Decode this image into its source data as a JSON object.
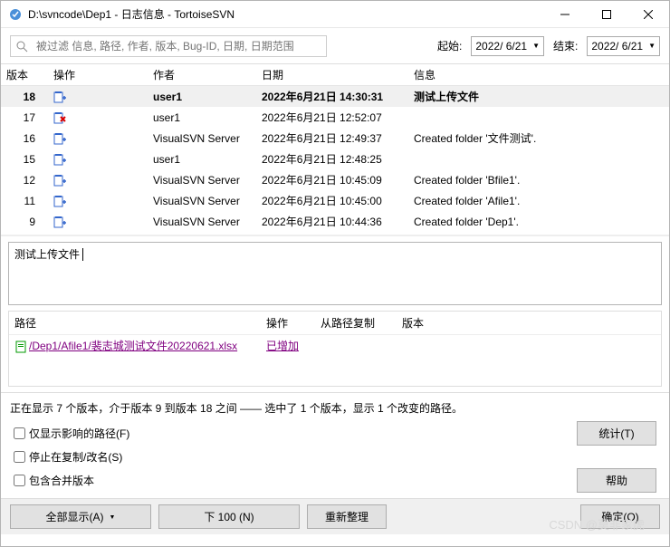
{
  "titlebar": {
    "text": "D:\\svncode\\Dep1 - 日志信息 - TortoiseSVN"
  },
  "toolbar": {
    "search_placeholder": "被过滤 信息, 路径, 作者, 版本, Bug-ID, 日期, 日期范围",
    "start_label": "起始:",
    "start_date": "2022/ 6/21",
    "end_label": "结束:",
    "end_date": "2022/ 6/21"
  },
  "log": {
    "headers": {
      "rev": "版本",
      "op": "操作",
      "author": "作者",
      "date": "日期",
      "msg": "信息"
    },
    "rows": [
      {
        "rev": "18",
        "op": "add",
        "author": "user1",
        "date": "2022年6月21日 14:30:31",
        "msg": "测试上传文件",
        "sel": true
      },
      {
        "rev": "17",
        "op": "del",
        "author": "user1",
        "date": "2022年6月21日 12:52:07",
        "msg": ""
      },
      {
        "rev": "16",
        "op": "add",
        "author": "VisualSVN Server",
        "date": "2022年6月21日 12:49:37",
        "msg": "Created folder '文件测试'."
      },
      {
        "rev": "15",
        "op": "add",
        "author": "user1",
        "date": "2022年6月21日 12:48:25",
        "msg": ""
      },
      {
        "rev": "12",
        "op": "add",
        "author": "VisualSVN Server",
        "date": "2022年6月21日 10:45:09",
        "msg": "Created folder 'Bfile1'."
      },
      {
        "rev": "11",
        "op": "add",
        "author": "VisualSVN Server",
        "date": "2022年6月21日 10:45:00",
        "msg": "Created folder 'Afile1'."
      },
      {
        "rev": "9",
        "op": "add",
        "author": "VisualSVN Server",
        "date": "2022年6月21日 10:44:36",
        "msg": "Created folder 'Dep1'."
      }
    ]
  },
  "message": "测试上传文件",
  "paths": {
    "headers": {
      "path": "路径",
      "op": "操作",
      "copy": "从路径复制",
      "rev": "版本"
    },
    "rows": [
      {
        "path": "/Dep1/Afile1/裴志城测试文件20220621.xlsx",
        "op": "已增加",
        "copy": "",
        "rev": ""
      }
    ]
  },
  "status": "正在显示 7 个版本，介于版本 9 到版本 18 之间 —— 选中了 1 个版本，显示 1 个改变的路径。",
  "opts": {
    "only_affected": "仅显示影响的路径(F)",
    "stop_on_copy": "停止在复制/改名(S)",
    "include_merge": "包含合并版本"
  },
  "buttons": {
    "stats": "统计(T)",
    "help": "帮助",
    "show_all": "全部显示(A)",
    "next100": "下 100 (N)",
    "refresh": "重新整理",
    "ok": "确定(O)"
  },
  "watermark": "CSDN @莫非家虎"
}
